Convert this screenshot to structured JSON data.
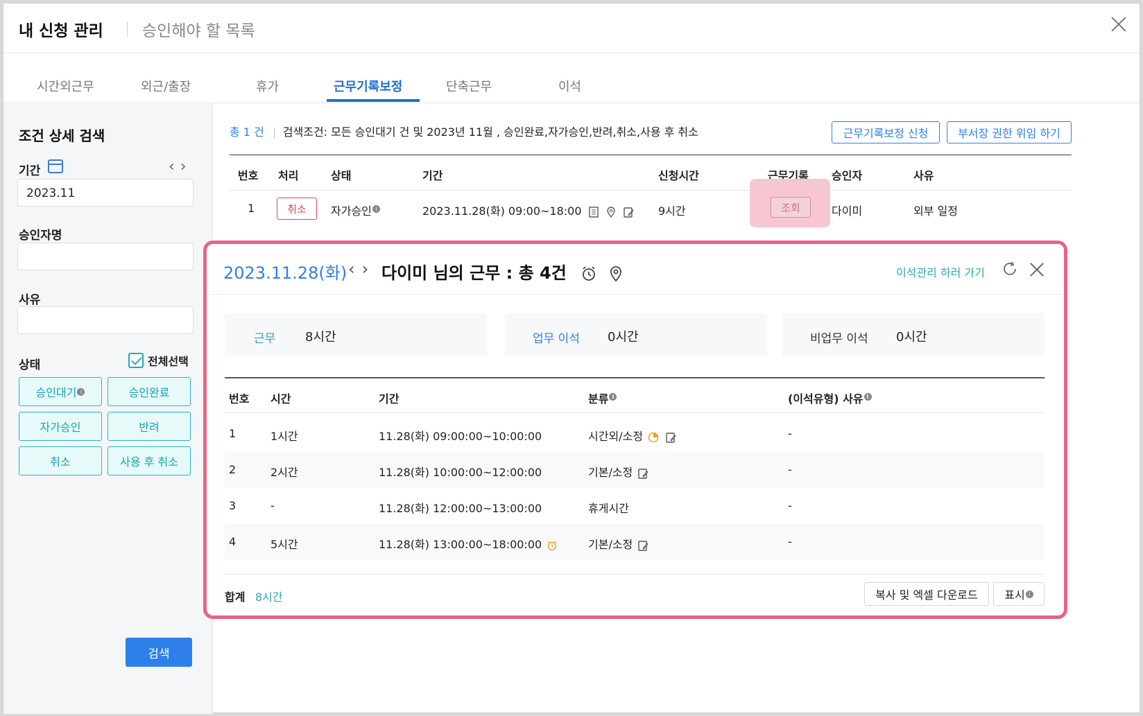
{
  "header": {
    "title": "내 신청 관리",
    "subtitle": "승인해야 할 목록"
  },
  "tabs": [
    "시간외근무",
    "외근/출장",
    "휴가",
    "근무기록보정",
    "단축근무",
    "이석"
  ],
  "sidebar": {
    "title": "조건 상세 검색",
    "period_label": "기간",
    "period_value": "2023.11",
    "approver_label": "승인자명",
    "reason_label": "사유",
    "status_label": "상태",
    "select_all": "전체선택",
    "status_buttons": [
      "승인대기",
      "승인완료",
      "자가승인",
      "반려",
      "취소",
      "사용 후 취소"
    ],
    "search_button": "검색"
  },
  "main": {
    "count": "총 1 건",
    "criteria": "검색조건: 모든 승인대기 건 및 2023년 11월 , 승인완료,자가승인,반려,취소,사용 후 취소",
    "apply_button": "근무기록보정 신청",
    "delegate_button": "부서장 권한 위임 하기",
    "columns": [
      "번호",
      "처리",
      "상태",
      "기간",
      "신청시간",
      "근무기록",
      "승인자",
      "사유"
    ],
    "row": {
      "no": "1",
      "action": "취소",
      "status": "자가승인",
      "period": "2023.11.28(화) 09:00~18:00",
      "hours": "9시간",
      "record": "조회",
      "approver": "다이미",
      "reason": "외부 일정"
    }
  },
  "popup": {
    "date": "2023.11.28(화)",
    "title": "다이미 님의 근무 : 총 4건",
    "link": "이석관리 하러 가기",
    "summary": [
      {
        "label": "근무",
        "value": "8시간"
      },
      {
        "label": "업무 이석",
        "value": "0시간"
      },
      {
        "label": "비업무 이석",
        "value": "0시간"
      }
    ],
    "columns": [
      "번호",
      "시간",
      "기간",
      "분류",
      "(이석유형) 사유"
    ],
    "rows": [
      {
        "no": "1",
        "time": "1시간",
        "period": "11.28(화) 09:00:00~10:00:00",
        "category": "시간외/소정",
        "reason": "-"
      },
      {
        "no": "2",
        "time": "2시간",
        "period": "11.28(화) 10:00:00~12:00:00",
        "category": "기본/소정",
        "reason": "-"
      },
      {
        "no": "3",
        "time": "-",
        "period": "11.28(화) 12:00:00~13:00:00",
        "category": "휴게시간",
        "reason": "-"
      },
      {
        "no": "4",
        "time": "5시간",
        "period": "11.28(화) 13:00:00~18:00:00",
        "category": "기본/소정",
        "reason": "-"
      }
    ],
    "total_label": "합계",
    "total_value": "8시간",
    "copy_button": "복사 및 엑셀 다운로드",
    "display_button": "표시"
  },
  "colors": {
    "primary": "#2e80e8",
    "teal": "#2aa7b0",
    "danger": "#e0454f",
    "highlight": "#e96385"
  }
}
